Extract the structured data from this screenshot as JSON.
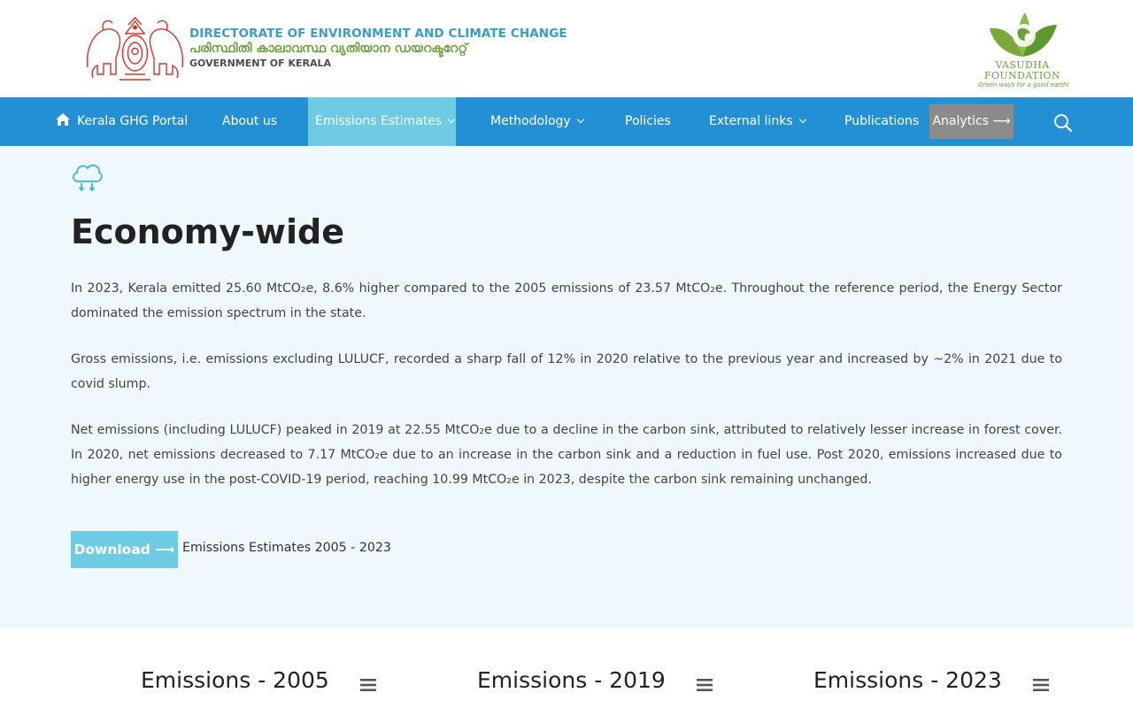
{
  "header": {
    "dept_en": "DIRECTORATE OF ENVIRONMENT AND CLIMATE CHANGE",
    "dept_ml": "പരിസ്ഥിതി കാലാവസ്ഥ വ്യതിയാന ഡയറക്ടറേറ്റ്",
    "government": "GOVERNMENT OF KERALA",
    "partner_name_1": "VASUDHA",
    "partner_name_2": "FOUNDATION",
    "partner_tagline": "Green ways for a good earth!",
    "emblem_icon": "kerala-emblem",
    "partner_icon": "vasudha-leaf-logo"
  },
  "nav": {
    "home_label": "Kerala GHG Portal",
    "items": [
      {
        "label": "About us",
        "has_dropdown": false
      },
      {
        "label": "Emissions Estimates",
        "has_dropdown": true,
        "active": true
      },
      {
        "label": "Methodology",
        "has_dropdown": true
      },
      {
        "label": "Policies",
        "has_dropdown": false
      },
      {
        "label": "External links",
        "has_dropdown": true
      },
      {
        "label": "Publications",
        "has_dropdown": false
      }
    ],
    "analytics_label": "Analytics ⟶",
    "search_icon": "search-icon",
    "colors": {
      "bar": "#2390d6",
      "active": "#6ecbe4",
      "analytics": "#8b8b8b"
    }
  },
  "main": {
    "icon": "cloud-icon",
    "title": "Economy-wide",
    "paragraphs": [
      "In 2023, Kerala emitted 25.60 MtCO₂e, 8.6% higher compared to the 2005 emissions of 23.57 MtCO₂e. Throughout the reference period, the Energy Sector dominated the emission spectrum in the state.",
      "Gross emissions, i.e. emissions excluding LULUCF, recorded a sharp fall of 12% in 2020 relative to the previous year and increased by ~2% in 2021 due to covid slump.",
      "Net emissions (including LULUCF) peaked in 2019 at 22.55 MtCO₂e due to a decline in the carbon sink, attributed to relatively lesser increase in forest cover. In 2020, net emissions decreased to 7.17 MtCO₂e due to an increase in the carbon sink and a reduction in fuel use. Post 2020, emissions increased due to higher energy use in the post-COVID-19 period, reaching 10.99 MtCO₂e in 2023, despite the carbon sink remaining unchanged."
    ],
    "download_label": "Download ⟶",
    "download_caption": "Emissions Estimates 2005 - 2023",
    "background": "#eef8fd"
  },
  "charts": [
    {
      "title": "Emissions - 2005",
      "menu_icon": "menu-icon"
    },
    {
      "title": "Emissions - 2019",
      "menu_icon": "menu-icon"
    },
    {
      "title": "Emissions - 2023",
      "menu_icon": "menu-icon"
    }
  ]
}
